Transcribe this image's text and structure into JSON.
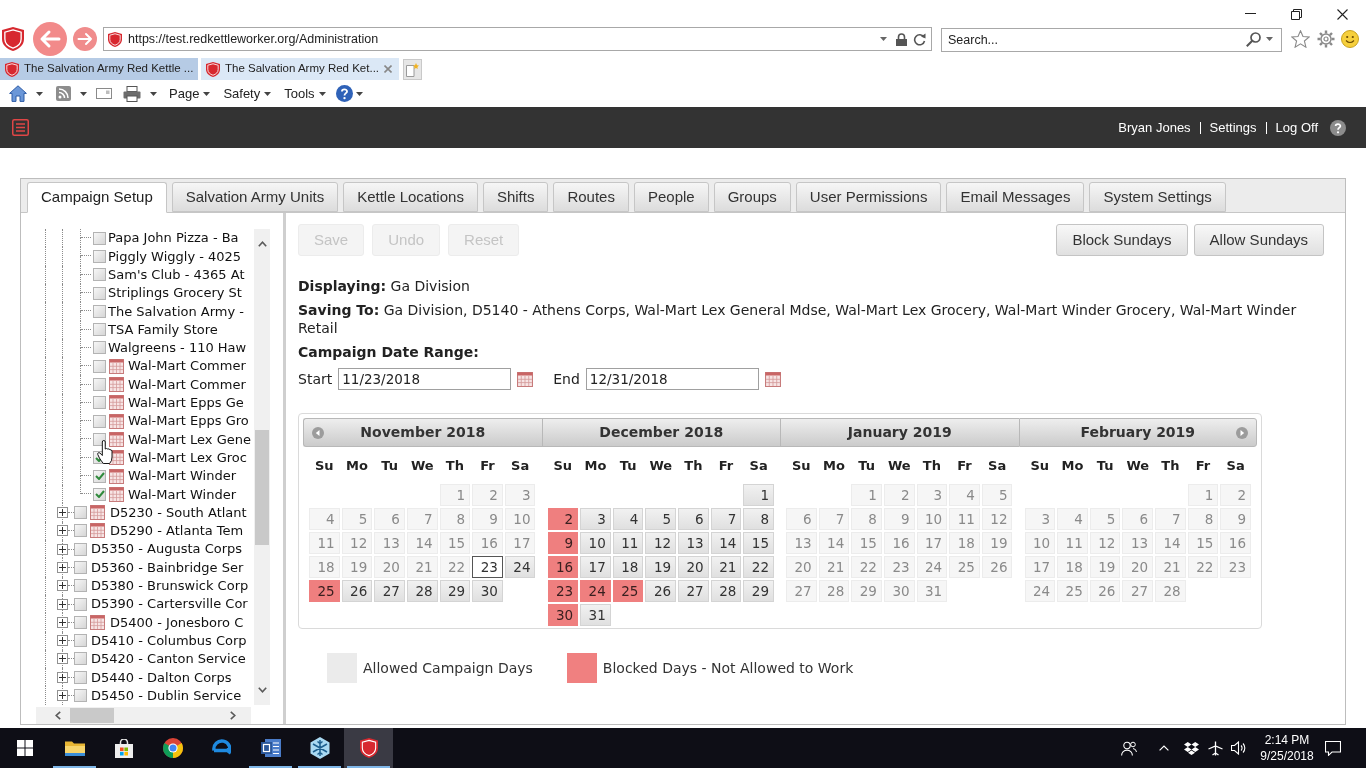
{
  "browser": {
    "address": "https://test.redkettleworker.org/Administration",
    "search": {
      "placeholder": "Search..."
    },
    "tabs": [
      {
        "title": "The Salvation Army Red Kettle ...",
        "selected": false
      },
      {
        "title": "The Salvation Army Red Ket...",
        "selected": true
      }
    ],
    "menus": [
      "Page",
      "Safety",
      "Tools"
    ]
  },
  "header": {
    "user": "Bryan Jones",
    "links": [
      "Settings",
      "Log Off"
    ]
  },
  "tabs": [
    {
      "label": "Campaign Setup",
      "selected": true
    },
    {
      "label": "Salvation Army Units",
      "selected": false
    },
    {
      "label": "Kettle Locations",
      "selected": false
    },
    {
      "label": "Shifts",
      "selected": false
    },
    {
      "label": "Routes",
      "selected": false
    },
    {
      "label": "People",
      "selected": false
    },
    {
      "label": "Groups",
      "selected": false
    },
    {
      "label": "User Permissions",
      "selected": false
    },
    {
      "label": "Email Messages",
      "selected": false
    },
    {
      "label": "System Settings",
      "selected": false
    }
  ],
  "tree": {
    "items": [
      {
        "children": [
          {
            "label": "Papa John Pizza - Ba",
            "checked": false,
            "calendar": false
          },
          {
            "label": "Piggly Wiggly - 4025",
            "checked": false,
            "calendar": false
          },
          {
            "label": "Sam's Club - 4365 At",
            "checked": false,
            "calendar": false
          },
          {
            "label": "Striplings Grocery St",
            "checked": false,
            "calendar": false
          },
          {
            "label": "The Salvation Army -",
            "checked": false,
            "calendar": false
          },
          {
            "label": "TSA Family Store",
            "checked": false,
            "calendar": false
          },
          {
            "label": "Walgreens - 110 Haw",
            "checked": false,
            "calendar": false
          },
          {
            "label": "Wal-Mart Commer",
            "checked": false,
            "calendar": true
          },
          {
            "label": "Wal-Mart Commer",
            "checked": false,
            "calendar": true
          },
          {
            "label": "Wal-Mart Epps Ge",
            "checked": false,
            "calendar": true
          },
          {
            "label": "Wal-Mart Epps Gro",
            "checked": false,
            "calendar": true
          },
          {
            "label": "Wal-Mart Lex Gene",
            "checked": false,
            "calendar": true
          },
          {
            "label": "Wal-Mart Lex Groc",
            "checked": true,
            "calendar": true
          },
          {
            "label": "Wal-Mart Winder",
            "checked": true,
            "calendar": true
          },
          {
            "label": "Wal-Mart Winder",
            "checked": true,
            "calendar": true
          }
        ]
      },
      {
        "label": "D5230 - South Atlant",
        "checked": false,
        "calendar": true,
        "expanded": false
      },
      {
        "label": "D5290 - Atlanta Tem",
        "checked": false,
        "calendar": true,
        "expanded": false
      },
      {
        "label": "D5350 - Augusta Corps",
        "checked": false,
        "calendar": false,
        "expanded": false
      },
      {
        "label": "D5360 - Bainbridge Ser",
        "checked": false,
        "calendar": false,
        "expanded": false
      },
      {
        "label": "D5380 - Brunswick Corp",
        "checked": false,
        "calendar": false,
        "expanded": false
      },
      {
        "label": "D5390 - Cartersville Cor",
        "checked": false,
        "calendar": false,
        "expanded": false
      },
      {
        "label": "D5400 - Jonesboro C",
        "checked": false,
        "calendar": true,
        "expanded": false
      },
      {
        "label": "D5410 - Columbus Corp",
        "checked": false,
        "calendar": false,
        "expanded": false
      },
      {
        "label": "D5420 - Canton Service",
        "checked": false,
        "calendar": false,
        "expanded": false
      },
      {
        "label": "D5440 - Dalton Corps",
        "checked": false,
        "calendar": false,
        "expanded": false
      },
      {
        "label": "D5450 - Dublin Service",
        "checked": false,
        "calendar": false,
        "expanded": false
      }
    ]
  },
  "edit_buttons": [
    {
      "label": "Save",
      "disabled": true
    },
    {
      "label": "Undo",
      "disabled": true
    },
    {
      "label": "Reset",
      "disabled": true
    }
  ],
  "sunday_buttons": [
    {
      "label": "Block Sundays",
      "disabled": false
    },
    {
      "label": "Allow Sundays",
      "disabled": false
    }
  ],
  "displaying": {
    "label": "Displaying:",
    "value": "Ga Division"
  },
  "saving_to": {
    "label": "Saving To:",
    "value": "Ga Division, D5140 - Athens Corps, Wal-Mart Lex General Mdse, Wal-Mart Lex Grocery, Wal-Mart Winder Grocery, Wal-Mart Winder Retail"
  },
  "date_range": {
    "title": "Campaign Date Range:",
    "fields": [
      {
        "label": "Start",
        "value": "11/23/2018"
      },
      {
        "label": "End",
        "value": "12/31/2018"
      }
    ]
  },
  "calendar": {
    "months": [
      {
        "title": "November 2018",
        "weekdays": [
          "Su",
          "Mo",
          "Tu",
          "We",
          "Th",
          "Fr",
          "Sa"
        ],
        "weeks": [
          [
            {
              "day": "1",
              "in_range": false,
              "blocked": false,
              "selected": false
            },
            {
              "day": "2",
              "in_range": false,
              "blocked": false,
              "selected": false
            },
            {
              "day": "3",
              "in_range": false,
              "blocked": false,
              "selected": false
            }
          ],
          [
            {
              "day": "4",
              "in_range": false,
              "blocked": false,
              "selected": false
            },
            {
              "day": "5",
              "in_range": false,
              "blocked": false,
              "selected": false
            },
            {
              "day": "6",
              "in_range": false,
              "blocked": false,
              "selected": false
            },
            {
              "day": "7",
              "in_range": false,
              "blocked": false,
              "selected": false
            },
            {
              "day": "8",
              "in_range": false,
              "blocked": false,
              "selected": false
            },
            {
              "day": "9",
              "in_range": false,
              "blocked": false,
              "selected": false
            },
            {
              "day": "10",
              "in_range": false,
              "blocked": false,
              "selected": false
            }
          ],
          [
            {
              "day": "11",
              "in_range": false,
              "blocked": false,
              "selected": false
            },
            {
              "day": "12",
              "in_range": false,
              "blocked": false,
              "selected": false
            },
            {
              "day": "13",
              "in_range": false,
              "blocked": false,
              "selected": false
            },
            {
              "day": "14",
              "in_range": false,
              "blocked": false,
              "selected": false
            },
            {
              "day": "15",
              "in_range": false,
              "blocked": false,
              "selected": false
            },
            {
              "day": "16",
              "in_range": false,
              "blocked": false,
              "selected": false
            },
            {
              "day": "17",
              "in_range": false,
              "blocked": false,
              "selected": false
            }
          ],
          [
            {
              "day": "18",
              "in_range": false,
              "blocked": false,
              "selected": false
            },
            {
              "day": "19",
              "in_range": false,
              "blocked": false,
              "selected": false
            },
            {
              "day": "20",
              "in_range": false,
              "blocked": false,
              "selected": false
            },
            {
              "day": "21",
              "in_range": false,
              "blocked": false,
              "selected": false
            },
            {
              "day": "22",
              "in_range": false,
              "blocked": false,
              "selected": false
            },
            {
              "day": "23",
              "in_range": true,
              "blocked": false,
              "selected": true
            },
            {
              "day": "24",
              "in_range": true,
              "blocked": false,
              "selected": false
            }
          ],
          [
            {
              "day": "25",
              "in_range": true,
              "blocked": true,
              "selected": false
            },
            {
              "day": "26",
              "in_range": true,
              "blocked": false,
              "selected": false
            },
            {
              "day": "27",
              "in_range": true,
              "blocked": false,
              "selected": false
            },
            {
              "day": "28",
              "in_range": true,
              "blocked": false,
              "selected": false
            },
            {
              "day": "29",
              "in_range": true,
              "blocked": false,
              "selected": false
            },
            {
              "day": "30",
              "in_range": true,
              "blocked": false,
              "selected": false
            }
          ]
        ]
      },
      {
        "title": "December 2018",
        "weekdays": [
          "Su",
          "Mo",
          "Tu",
          "We",
          "Th",
          "Fr",
          "Sa"
        ],
        "weeks": [
          [
            {
              "day": "1",
              "in_range": true,
              "blocked": false,
              "selected": false
            }
          ],
          [
            {
              "day": "2",
              "in_range": true,
              "blocked": true,
              "selected": false
            },
            {
              "day": "3",
              "in_range": true,
              "blocked": false,
              "selected": false
            },
            {
              "day": "4",
              "in_range": true,
              "blocked": false,
              "selected": false
            },
            {
              "day": "5",
              "in_range": true,
              "blocked": false,
              "selected": false
            },
            {
              "day": "6",
              "in_range": true,
              "blocked": false,
              "selected": false
            },
            {
              "day": "7",
              "in_range": true,
              "blocked": false,
              "selected": false
            },
            {
              "day": "8",
              "in_range": true,
              "blocked": false,
              "selected": false
            }
          ],
          [
            {
              "day": "9",
              "in_range": true,
              "blocked": true,
              "selected": false
            },
            {
              "day": "10",
              "in_range": true,
              "blocked": false,
              "selected": false
            },
            {
              "day": "11",
              "in_range": true,
              "blocked": false,
              "selected": false
            },
            {
              "day": "12",
              "in_range": true,
              "blocked": false,
              "selected": false
            },
            {
              "day": "13",
              "in_range": true,
              "blocked": false,
              "selected": false
            },
            {
              "day": "14",
              "in_range": true,
              "blocked": false,
              "selected": false
            },
            {
              "day": "15",
              "in_range": true,
              "blocked": false,
              "selected": false
            }
          ],
          [
            {
              "day": "16",
              "in_range": true,
              "blocked": true,
              "selected": false
            },
            {
              "day": "17",
              "in_range": true,
              "blocked": false,
              "selected": false
            },
            {
              "day": "18",
              "in_range": true,
              "blocked": false,
              "selected": false
            },
            {
              "day": "19",
              "in_range": true,
              "blocked": false,
              "selected": false
            },
            {
              "day": "20",
              "in_range": true,
              "blocked": false,
              "selected": false
            },
            {
              "day": "21",
              "in_range": true,
              "blocked": false,
              "selected": false
            },
            {
              "day": "22",
              "in_range": true,
              "blocked": false,
              "selected": false
            }
          ],
          [
            {
              "day": "23",
              "in_range": true,
              "blocked": true,
              "selected": false
            },
            {
              "day": "24",
              "in_range": true,
              "blocked": true,
              "selected": false
            },
            {
              "day": "25",
              "in_range": true,
              "blocked": true,
              "selected": false
            },
            {
              "day": "26",
              "in_range": true,
              "blocked": false,
              "selected": false
            },
            {
              "day": "27",
              "in_range": true,
              "blocked": false,
              "selected": false
            },
            {
              "day": "28",
              "in_range": true,
              "blocked": false,
              "selected": false
            },
            {
              "day": "29",
              "in_range": true,
              "blocked": false,
              "selected": false
            }
          ],
          [
            {
              "day": "30",
              "in_range": true,
              "blocked": true,
              "selected": false
            },
            {
              "day": "31",
              "in_range": true,
              "blocked": false,
              "selected": false
            }
          ]
        ]
      },
      {
        "title": "January 2019",
        "weekdays": [
          "Su",
          "Mo",
          "Tu",
          "We",
          "Th",
          "Fr",
          "Sa"
        ],
        "weeks": [
          [
            {
              "day": "1",
              "in_range": false,
              "blocked": false,
              "selected": false
            },
            {
              "day": "2",
              "in_range": false,
              "blocked": false,
              "selected": false
            },
            {
              "day": "3",
              "in_range": false,
              "blocked": false,
              "selected": false
            },
            {
              "day": "4",
              "in_range": false,
              "blocked": false,
              "selected": false
            },
            {
              "day": "5",
              "in_range": false,
              "blocked": false,
              "selected": false
            }
          ],
          [
            {
              "day": "6",
              "in_range": false,
              "blocked": false,
              "selected": false
            },
            {
              "day": "7",
              "in_range": false,
              "blocked": false,
              "selected": false
            },
            {
              "day": "8",
              "in_range": false,
              "blocked": false,
              "selected": false
            },
            {
              "day": "9",
              "in_range": false,
              "blocked": false,
              "selected": false
            },
            {
              "day": "10",
              "in_range": false,
              "blocked": false,
              "selected": false
            },
            {
              "day": "11",
              "in_range": false,
              "blocked": false,
              "selected": false
            },
            {
              "day": "12",
              "in_range": false,
              "blocked": false,
              "selected": false
            }
          ],
          [
            {
              "day": "13",
              "in_range": false,
              "blocked": false,
              "selected": false
            },
            {
              "day": "14",
              "in_range": false,
              "blocked": false,
              "selected": false
            },
            {
              "day": "15",
              "in_range": false,
              "blocked": false,
              "selected": false
            },
            {
              "day": "16",
              "in_range": false,
              "blocked": false,
              "selected": false
            },
            {
              "day": "17",
              "in_range": false,
              "blocked": false,
              "selected": false
            },
            {
              "day": "18",
              "in_range": false,
              "blocked": false,
              "selected": false
            },
            {
              "day": "19",
              "in_range": false,
              "blocked": false,
              "selected": false
            }
          ],
          [
            {
              "day": "20",
              "in_range": false,
              "blocked": false,
              "selected": false
            },
            {
              "day": "21",
              "in_range": false,
              "blocked": false,
              "selected": false
            },
            {
              "day": "22",
              "in_range": false,
              "blocked": false,
              "selected": false
            },
            {
              "day": "23",
              "in_range": false,
              "blocked": false,
              "selected": false
            },
            {
              "day": "24",
              "in_range": false,
              "blocked": false,
              "selected": false
            },
            {
              "day": "25",
              "in_range": false,
              "blocked": false,
              "selected": false
            },
            {
              "day": "26",
              "in_range": false,
              "blocked": false,
              "selected": false
            }
          ],
          [
            {
              "day": "27",
              "in_range": false,
              "blocked": false,
              "selected": false
            },
            {
              "day": "28",
              "in_range": false,
              "blocked": false,
              "selected": false
            },
            {
              "day": "29",
              "in_range": false,
              "blocked": false,
              "selected": false
            },
            {
              "day": "30",
              "in_range": false,
              "blocked": false,
              "selected": false
            },
            {
              "day": "31",
              "in_range": false,
              "blocked": false,
              "selected": false
            }
          ]
        ]
      },
      {
        "title": "February 2019",
        "weekdays": [
          "Su",
          "Mo",
          "Tu",
          "We",
          "Th",
          "Fr",
          "Sa"
        ],
        "weeks": [
          [
            {
              "day": "1",
              "in_range": false,
              "blocked": false,
              "selected": false
            },
            {
              "day": "2",
              "in_range": false,
              "blocked": false,
              "selected": false
            }
          ],
          [
            {
              "day": "3",
              "in_range": false,
              "blocked": false,
              "selected": false
            },
            {
              "day": "4",
              "in_range": false,
              "blocked": false,
              "selected": false
            },
            {
              "day": "5",
              "in_range": false,
              "blocked": false,
              "selected": false
            },
            {
              "day": "6",
              "in_range": false,
              "blocked": false,
              "selected": false
            },
            {
              "day": "7",
              "in_range": false,
              "blocked": false,
              "selected": false
            },
            {
              "day": "8",
              "in_range": false,
              "blocked": false,
              "selected": false
            },
            {
              "day": "9",
              "in_range": false,
              "blocked": false,
              "selected": false
            }
          ],
          [
            {
              "day": "10",
              "in_range": false,
              "blocked": false,
              "selected": false
            },
            {
              "day": "11",
              "in_range": false,
              "blocked": false,
              "selected": false
            },
            {
              "day": "12",
              "in_range": false,
              "blocked": false,
              "selected": false
            },
            {
              "day": "13",
              "in_range": false,
              "blocked": false,
              "selected": false
            },
            {
              "day": "14",
              "in_range": false,
              "blocked": false,
              "selected": false
            },
            {
              "day": "15",
              "in_range": false,
              "blocked": false,
              "selected": false
            },
            {
              "day": "16",
              "in_range": false,
              "blocked": false,
              "selected": false
            }
          ],
          [
            {
              "day": "17",
              "in_range": false,
              "blocked": false,
              "selected": false
            },
            {
              "day": "18",
              "in_range": false,
              "blocked": false,
              "selected": false
            },
            {
              "day": "19",
              "in_range": false,
              "blocked": false,
              "selected": false
            },
            {
              "day": "20",
              "in_range": false,
              "blocked": false,
              "selected": false
            },
            {
              "day": "21",
              "in_range": false,
              "blocked": false,
              "selected": false
            },
            {
              "day": "22",
              "in_range": false,
              "blocked": false,
              "selected": false
            },
            {
              "day": "23",
              "in_range": false,
              "blocked": false,
              "selected": false
            }
          ],
          [
            {
              "day": "24",
              "in_range": false,
              "blocked": false,
              "selected": false
            },
            {
              "day": "25",
              "in_range": false,
              "blocked": false,
              "selected": false
            },
            {
              "day": "26",
              "in_range": false,
              "blocked": false,
              "selected": false
            },
            {
              "day": "27",
              "in_range": false,
              "blocked": false,
              "selected": false
            },
            {
              "day": "28",
              "in_range": false,
              "blocked": false,
              "selected": false
            }
          ]
        ]
      }
    ]
  },
  "legend": [
    {
      "label": "Allowed Campaign Days",
      "color": "#ebebeb"
    },
    {
      "label": "Blocked Days - Not Allowed to Work",
      "color": "#f08080"
    }
  ],
  "taskbar": {
    "apps": [
      {
        "kind": "folder",
        "running": true,
        "active": false
      },
      {
        "kind": "bag",
        "running": false,
        "active": false
      },
      {
        "kind": "wheel",
        "running": false,
        "active": false
      },
      {
        "kind": "swirl",
        "running": false,
        "active": false
      },
      {
        "kind": "document",
        "running": true,
        "active": false
      },
      {
        "kind": "snowflake",
        "running": true,
        "active": false
      },
      {
        "kind": "shield",
        "running": true,
        "active": true
      }
    ],
    "time": "2:14 PM",
    "date": "9/25/2018"
  }
}
